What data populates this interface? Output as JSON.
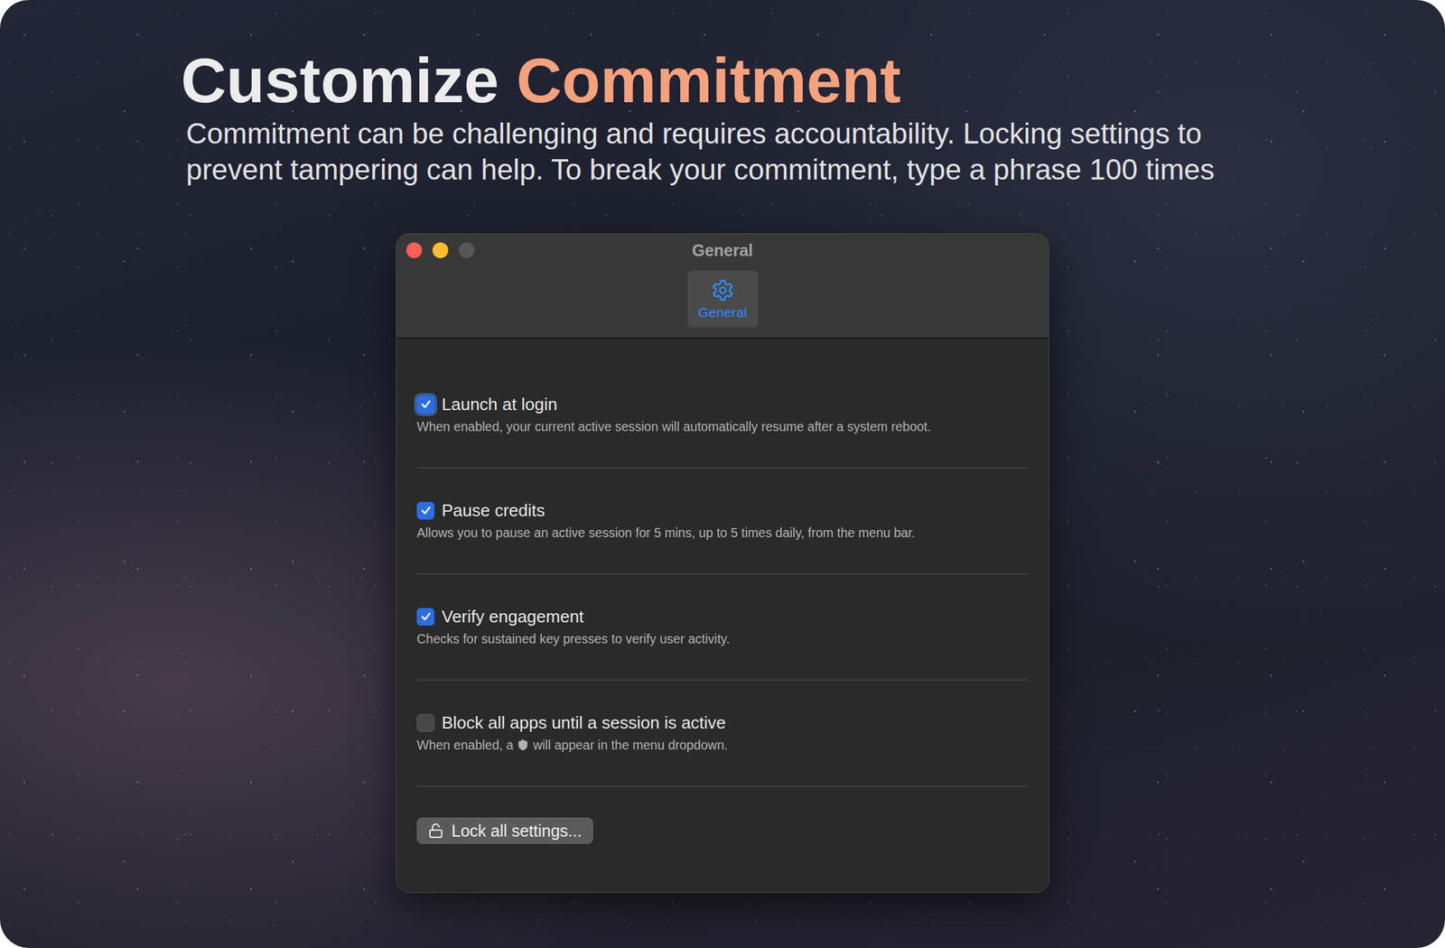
{
  "hero": {
    "title": "Customize",
    "title_accent": "Commitment",
    "subtitle_lines": [
      "Commitment can be challenging and requires accountability. Locking settings to",
      "prevent tampering can help. To break your commitment, type a phrase 100 times"
    ]
  },
  "window": {
    "title": "General"
  },
  "tabs": [
    {
      "label": "General",
      "selected": true
    }
  ],
  "settings": [
    {
      "label": "Launch at login",
      "checked": true,
      "focused": true,
      "description": [
        "When enabled, your current active session will automatically resume after a system reboot."
      ]
    },
    {
      "label": "Pause credits",
      "checked": true,
      "focused": false,
      "description": [
        "Allows you to pause an active session for 5 mins, up to 5 times daily, from the menu bar."
      ]
    },
    {
      "label": "Verify engagement",
      "checked": true,
      "focused": false,
      "description": [
        "Checks for sustained key presses to verify user activity."
      ]
    },
    {
      "label": "Block all apps until a session is active",
      "checked": false,
      "focused": false,
      "description": [
        "When enabled, a",
        "will appear in the menu dropdown."
      ]
    }
  ],
  "buttons": [
    {
      "label": "Lock all settings...",
      "locked": false
    }
  ]
}
